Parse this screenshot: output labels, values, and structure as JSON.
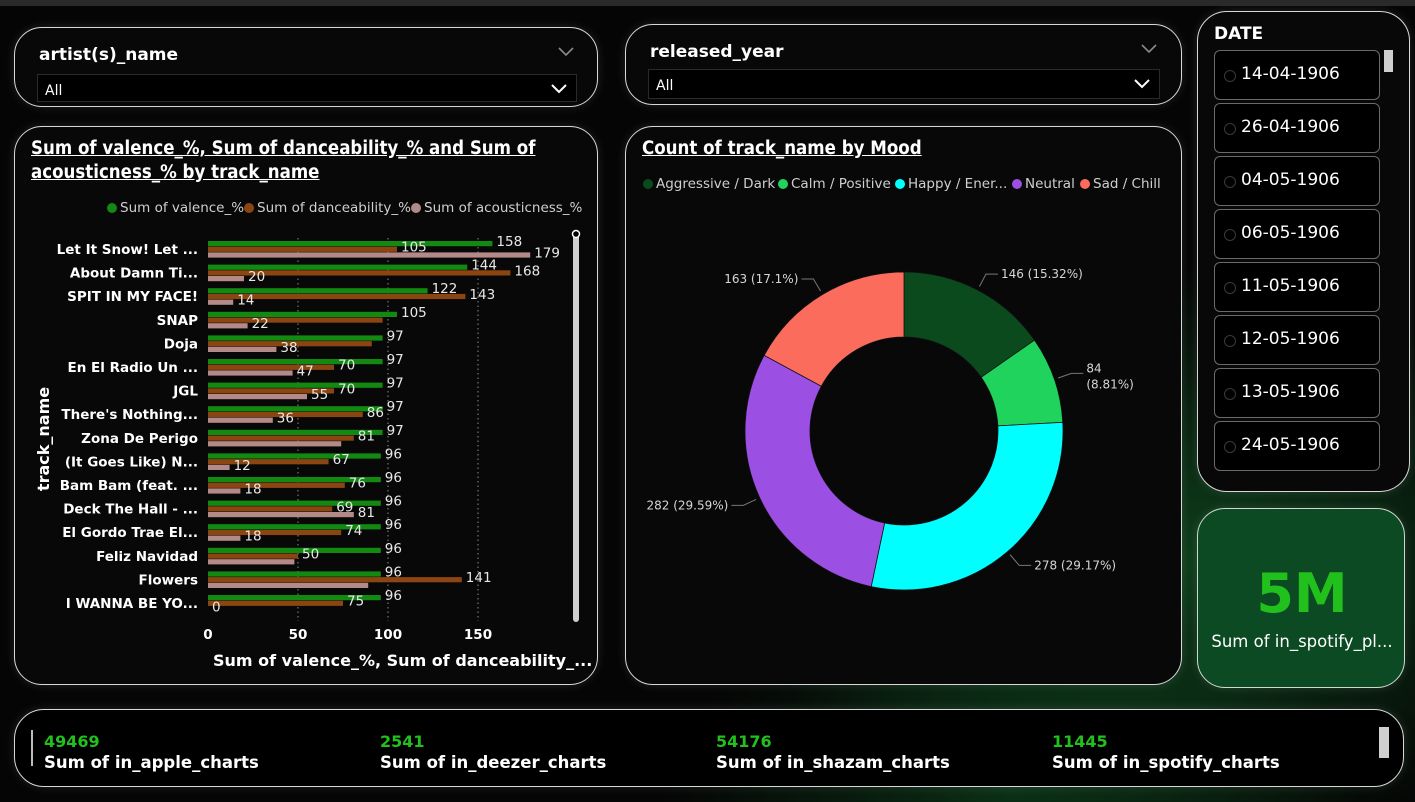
{
  "slicers": {
    "artist": {
      "title": "artist(s)_name",
      "value": "All"
    },
    "year": {
      "title": "released_year",
      "value": "All"
    }
  },
  "bar_chart": {
    "title_line1": "Sum of valence_%, Sum of danceability_% and Sum of",
    "title_line2": "acousticness_% by track_name",
    "legend": [
      "Sum of valence_%",
      "Sum of danceability_%",
      "Sum of acousticness_%"
    ],
    "ylabel": "track_name",
    "xlabel": "Sum of valence_%, Sum of danceability_...",
    "xticks": [
      "0",
      "50",
      "100",
      "150"
    ]
  },
  "donut": {
    "title": "Count of track_name by Mood",
    "legend": [
      "Aggressive / Dark",
      "Calm / Positive",
      "Happy / Ener...",
      "Neutral",
      "Sad / Chill"
    ]
  },
  "date_slicer": {
    "title": "DATE",
    "dates": [
      "14-04-1906",
      "26-04-1906",
      "04-05-1906",
      "06-05-1906",
      "11-05-1906",
      "12-05-1906",
      "13-05-1906",
      "24-05-1906"
    ]
  },
  "card": {
    "value": "5M",
    "label": "Sum of in_spotify_pl..."
  },
  "kpis": [
    {
      "value": "49469",
      "label": "Sum of in_apple_charts"
    },
    {
      "value": "2541",
      "label": "Sum of in_deezer_charts"
    },
    {
      "value": "54176",
      "label": "Sum of in_shazam_charts"
    },
    {
      "value": "11445",
      "label": "Sum of in_spotify_charts"
    }
  ],
  "colors": {
    "valence": "#128a12",
    "danceability": "#8b4510",
    "acousticness": "#b48a88",
    "kpi_green": "#22c01c"
  },
  "chart_data": [
    {
      "type": "bar",
      "orientation": "horizontal",
      "categories": [
        "Let It Snow! Let ...",
        "About Damn Ti...",
        "SPIT IN MY FACE!",
        "SNAP",
        "Doja",
        "En El Radio Un ...",
        "JGL",
        "There's Nothing...",
        "Zona De Perigo",
        "(It Goes Like) N...",
        "Bam Bam (feat. ...",
        "Deck The Hall - ...",
        "El Gordo Trae El...",
        "Feliz Navidad",
        "Flowers",
        "I WANNA BE YO..."
      ],
      "series": [
        {
          "name": "Sum of valence_%",
          "values": [
            158,
            144,
            122,
            105,
            97,
            97,
            97,
            97,
            97,
            96,
            96,
            96,
            96,
            96,
            96,
            96
          ]
        },
        {
          "name": "Sum of danceability_%",
          "values": [
            105,
            168,
            143,
            97,
            91,
            70,
            70,
            86,
            81,
            67,
            76,
            69,
            74,
            50,
            141,
            75
          ]
        },
        {
          "name": "Sum of acousticness_%",
          "values": [
            179,
            20,
            14,
            22,
            38,
            47,
            55,
            36,
            74,
            12,
            18,
            81,
            18,
            48,
            89,
            0
          ]
        }
      ],
      "data_labels": [
        [
          "158",
          "105",
          "179"
        ],
        [
          "144",
          "168",
          "20"
        ],
        [
          "122",
          "143",
          "14"
        ],
        [
          "105",
          "",
          "22"
        ],
        [
          "97",
          "",
          "38"
        ],
        [
          "97",
          "70",
          "47"
        ],
        [
          "97",
          "70",
          "55"
        ],
        [
          "97",
          "86",
          "36"
        ],
        [
          "97",
          "81",
          ""
        ],
        [
          "96",
          "67",
          "12"
        ],
        [
          "96",
          "76",
          "18"
        ],
        [
          "96",
          "69",
          "81"
        ],
        [
          "96",
          "74",
          "18"
        ],
        [
          "96",
          "50",
          ""
        ],
        [
          "96",
          "141",
          ""
        ],
        [
          "96",
          "75",
          "0"
        ]
      ],
      "xlim": [
        0,
        190
      ],
      "ylabel": "track_name",
      "xlabel": "Sum of valence_%, Sum of danceability_...",
      "legend_position": "top"
    },
    {
      "type": "pie",
      "subtype": "donut",
      "categories": [
        "Aggressive / Dark",
        "Calm / Positive",
        "Happy / Ener...",
        "Neutral",
        "Sad / Chill"
      ],
      "values": [
        146,
        84,
        278,
        282,
        163
      ],
      "labels": [
        "146 (15.32%)",
        "84 (8.81%)",
        "278 (29.17%)",
        "282 (29.59%)",
        "163 (17.1%)"
      ],
      "colors": [
        "#0b4a1c",
        "#1fd35d",
        "#00ffff",
        "#9b4fe3",
        "#fb6c5c"
      ],
      "legend_position": "top"
    }
  ]
}
